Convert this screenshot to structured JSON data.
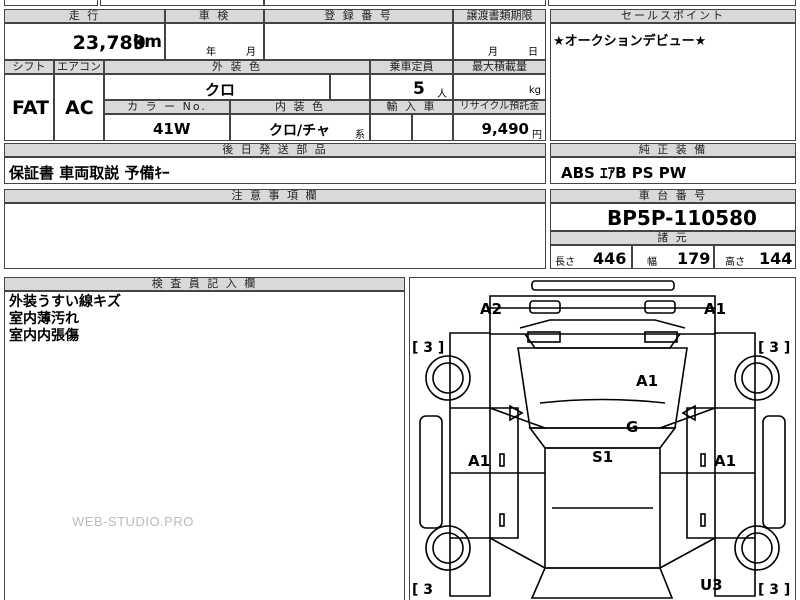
{
  "headers": {
    "mileage": "走 行",
    "inspection": "車 検",
    "registration": "登 録 番 号",
    "transfer_deadline": "譲渡書類期限",
    "sales_point": "セールスポイント",
    "shift": "シフト",
    "aircon": "エアコン",
    "exterior_color": "外 装 色",
    "seats": "乗車定員",
    "max_load": "最大積載量",
    "color_no": "カ ラ ー No.",
    "interior_color": "内 装 色",
    "import": "輸 入 車",
    "recycle": "リサイクル預託金",
    "later_parts": "後 日 発 送 部 品",
    "standard_equipment": "純 正 装 備",
    "notes": "注 意 事 項 欄",
    "chassis_no": "車 台 番 号",
    "specs": "諸 元",
    "inspector": "検 査 員 記 入 欄"
  },
  "vehicle": {
    "mileage": "23,789",
    "mileage_unit": "km",
    "year_unit": "年",
    "month_unit": "月",
    "deadline_month": "月",
    "deadline_day": "日",
    "shift": "FAT",
    "aircon": "AC",
    "exterior_color": "クロ",
    "seats": "5",
    "seats_unit": "人",
    "load_unit": "kg",
    "color_no": "41W",
    "interior_color": "クロ/チャ",
    "interior_suffix": "系",
    "recycle_fee": "9,490",
    "recycle_unit": "円",
    "sales_point": "★オークションデビュー★",
    "later_parts": "保証書  車両取説  予備ｷｰ",
    "equipment": "ABS  ｴｱB  PS  PW",
    "chassis_number": "BP5P-110580",
    "length_label": "長さ",
    "length": "446",
    "width_label": "幅",
    "width": "179",
    "height_label": "高さ",
    "height": "144"
  },
  "inspector_notes": [
    "外装うすい線キズ",
    "室内薄汚れ",
    "室内内張傷"
  ],
  "diagram": {
    "marks": {
      "front_left": "A2",
      "front_right": "A1",
      "hood": "A1",
      "windshield": "G",
      "roof": "S1",
      "left_door": "A1",
      "right_door": "A1",
      "rear_right": "U3"
    },
    "tire_tl": "[ 3 ]",
    "tire_tr": "[ 3 ]",
    "tire_bl": "[ 3",
    "tire_br": "[ 3 ]"
  },
  "watermark": "WEB-STUDIO.PRO"
}
